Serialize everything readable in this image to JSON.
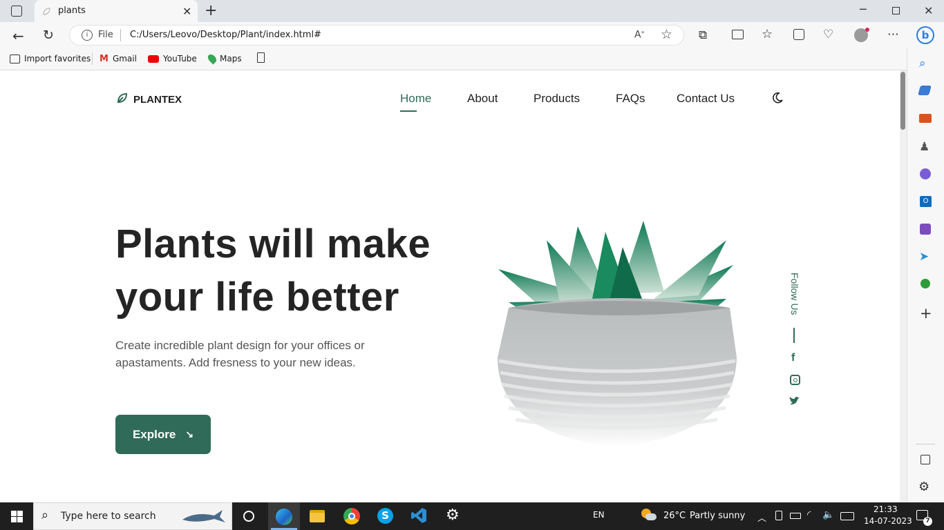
{
  "browser": {
    "tab_title": "plants",
    "url_prefix": "File",
    "url": "C:/Users/Leovo/Desktop/Plant/index.html#",
    "favorites": [
      {
        "label": "Import favorites",
        "icon": "import-icon"
      },
      {
        "label": "Gmail",
        "icon": "gmail-icon"
      },
      {
        "label": "YouTube",
        "icon": "youtube-icon"
      },
      {
        "label": "Maps",
        "icon": "maps-icon"
      }
    ]
  },
  "site": {
    "logo_text": "PLANTEX",
    "nav": [
      "Home",
      "About",
      "Products",
      "FAQs",
      "Contact Us"
    ],
    "active_nav": "Home",
    "hero_line1": "Plants will make",
    "hero_line2": "your life better",
    "hero_desc": "Create incredible plant design for your offices or apastaments. Add fresness to your new ideas.",
    "explore_label": "Explore",
    "follow_label": "Follow Us",
    "accent": "#2f6b58"
  },
  "taskbar": {
    "search_placeholder": "Type here to search",
    "language": "EN",
    "weather_temp": "26°C",
    "weather_desc": "Partly sunny",
    "time": "21:33",
    "date": "14-07-2023",
    "notification_count": "7"
  }
}
